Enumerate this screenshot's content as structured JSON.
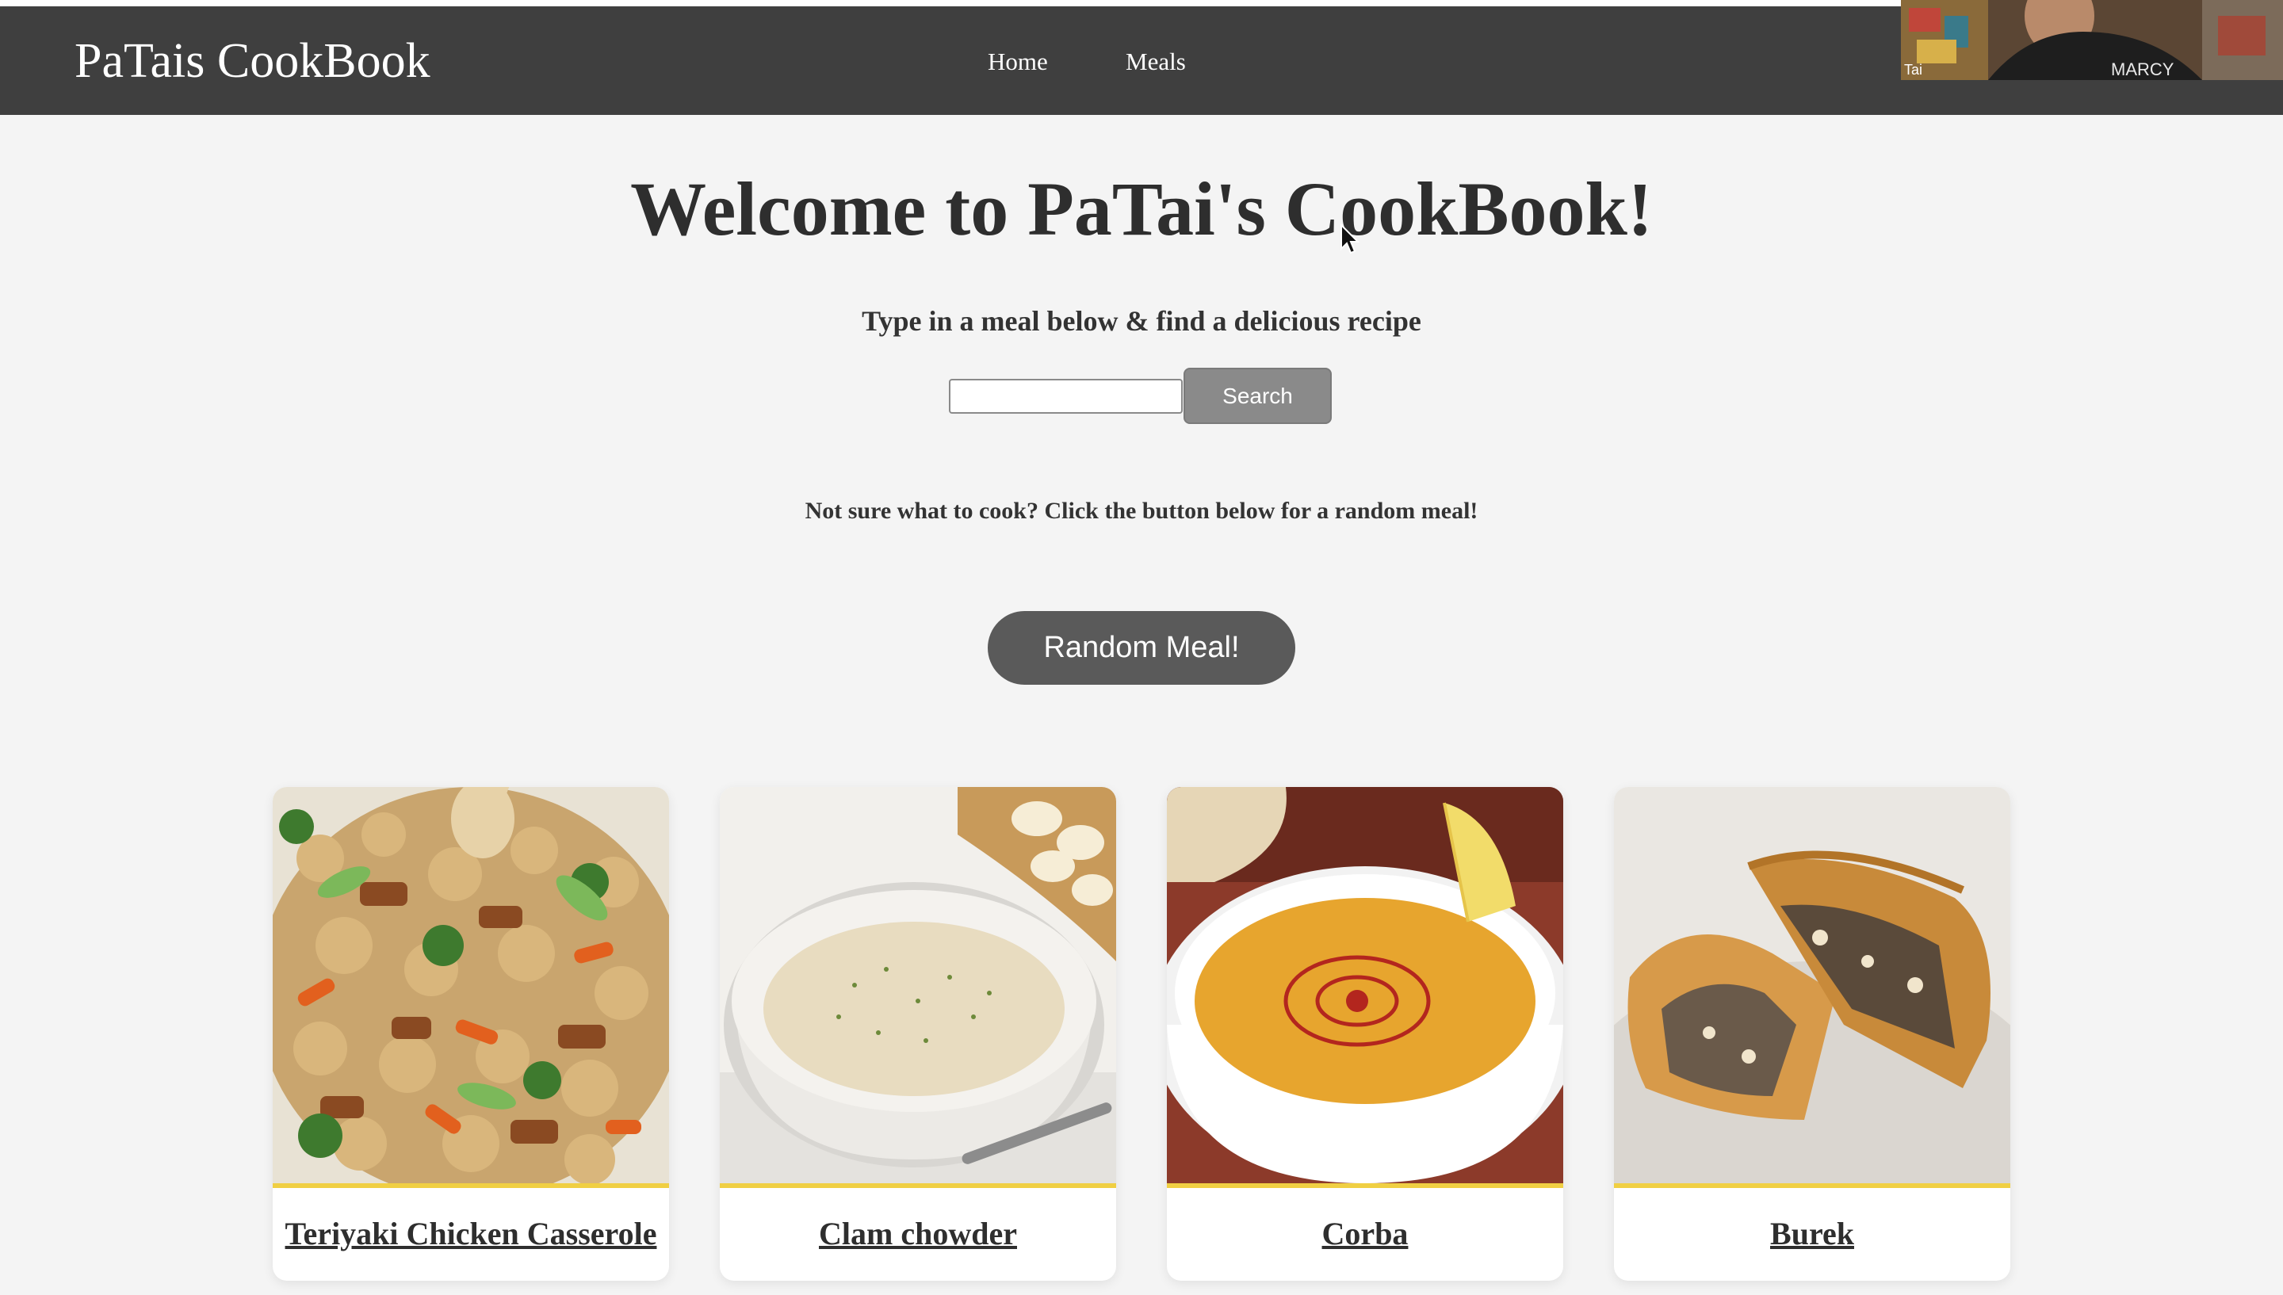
{
  "navbar": {
    "brand": "PaTais CookBook",
    "links": [
      "Home",
      "Meals"
    ]
  },
  "webcam": {
    "name": "Tai"
  },
  "hero": {
    "title": "Welcome to PaTai's CookBook!",
    "subtitle": "Type in a meal below & find a delicious recipe"
  },
  "search": {
    "value": "",
    "placeholder": "",
    "button_label": "Search"
  },
  "random": {
    "prompt": "Not sure what to cook? Click the button below for a random meal!",
    "button_label": "Random Meal!"
  },
  "meals": [
    {
      "title": "Teriyaki Chicken Casserole",
      "image_icon": "teriyaki-chicken-casserole-photo"
    },
    {
      "title": "Clam chowder",
      "image_icon": "clam-chowder-photo"
    },
    {
      "title": "Corba",
      "image_icon": "corba-photo"
    },
    {
      "title": "Burek",
      "image_icon": "burek-photo"
    }
  ],
  "colors": {
    "navbar": "#3f3f3f",
    "background": "#f4f4f4",
    "search_button": "#8a8a8a",
    "random_button": "#5a5a5a",
    "card_stripe": "#f0cf43"
  }
}
